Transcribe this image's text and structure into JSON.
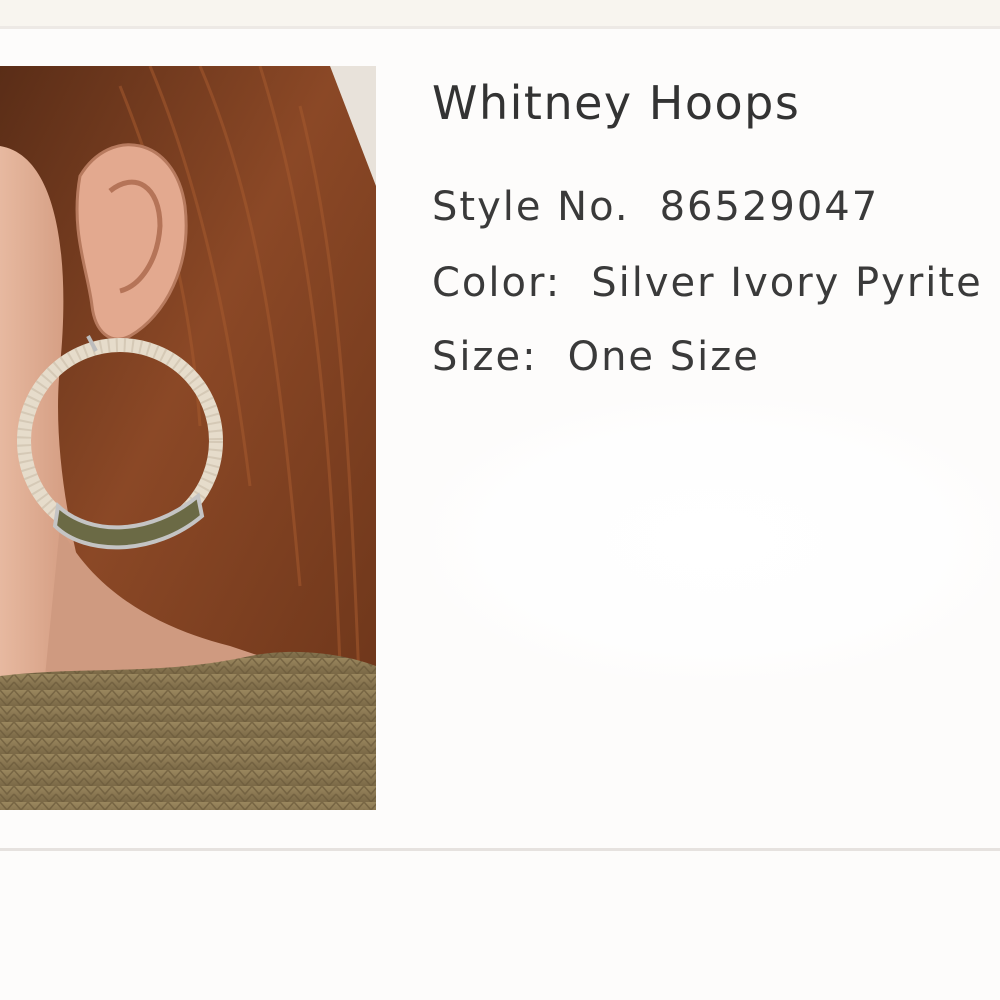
{
  "product": {
    "title": "Whitney Hoops",
    "style": {
      "label": "Style No.",
      "value": "86529047"
    },
    "color": {
      "label": "Color:",
      "value": "Silver Ivory Pyrite"
    },
    "size": {
      "label": "Size:",
      "value": "One Size"
    }
  },
  "colors": {
    "page_background": "#fbfaf8",
    "text": "#333333",
    "divider": "#e6e2df",
    "hair": "#8a4a2a",
    "sweater": "#8c7a56",
    "skin": "#d9a48a",
    "hoop_wrap": "#e6dccb",
    "pyrite": "#6b6a45"
  }
}
